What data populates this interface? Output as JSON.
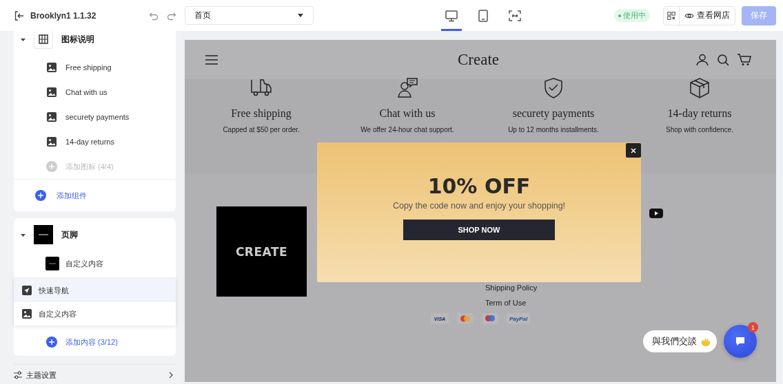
{
  "topbar": {
    "title": "Brooklyn1 1.1.32",
    "page_select": {
      "value": "首页"
    },
    "devices": [
      {
        "kind": "desktop",
        "selected": true
      },
      {
        "kind": "tablet",
        "selected": false
      },
      {
        "kind": "fullscreen",
        "selected": false
      }
    ],
    "status": {
      "label": "使用中"
    },
    "view_store": "查看网店",
    "save": {
      "label": "保存",
      "disabled": true
    }
  },
  "sidebar": {
    "sections": [
      {
        "title": "图标说明",
        "kind": "grid",
        "expanded": true,
        "items": [
          {
            "kind": "image",
            "label": "Free shipping"
          },
          {
            "kind": "image",
            "label": "Chat with us"
          },
          {
            "kind": "image",
            "label": "securety payments"
          },
          {
            "kind": "image",
            "label": "14-day returns"
          }
        ],
        "add_item": {
          "label": "添加图标 (4/4)",
          "disabled": true
        },
        "add_block": "添加组件"
      },
      {
        "title": "页脚",
        "kind": "logo",
        "expanded": true,
        "items": [
          {
            "kind": "logo",
            "label": "自定义内容"
          }
        ],
        "menu": [
          {
            "kind": "nav",
            "label": "快速导航",
            "selected": true
          },
          {
            "kind": "image",
            "label": "自定义内容",
            "selected": false
          }
        ],
        "add_item": {
          "label": "添加内容 (3/12)",
          "disabled": false
        }
      }
    ],
    "theme_settings": "主题设置"
  },
  "preview": {
    "store_name": "Create",
    "features": [
      {
        "kind": "truck",
        "title": "Free shipping",
        "text": "Capped at $50 per order."
      },
      {
        "kind": "chat",
        "title": "Chat with us",
        "text": "We offer 24-hour chat support."
      },
      {
        "kind": "shield",
        "title": "securety payments",
        "text": "Up to 12 months installments."
      },
      {
        "kind": "box",
        "title": "14-day returns",
        "text": "Shop with confidence."
      }
    ],
    "footer": {
      "logo": "CREATE",
      "links": [
        "Shipping Policy",
        "Term of Use"
      ],
      "payments": [
        {
          "kind": "visa",
          "label": "VISA"
        },
        {
          "kind": "mastercard"
        },
        {
          "kind": "maestro"
        },
        {
          "kind": "paypal",
          "label": "PayPal"
        }
      ]
    }
  },
  "popup": {
    "title": "10% OFF",
    "text": "Copy the code now and enjoy your shopping!",
    "button": "SHOP NOW"
  },
  "chat": {
    "label": "與我們交談",
    "badge": "1"
  }
}
